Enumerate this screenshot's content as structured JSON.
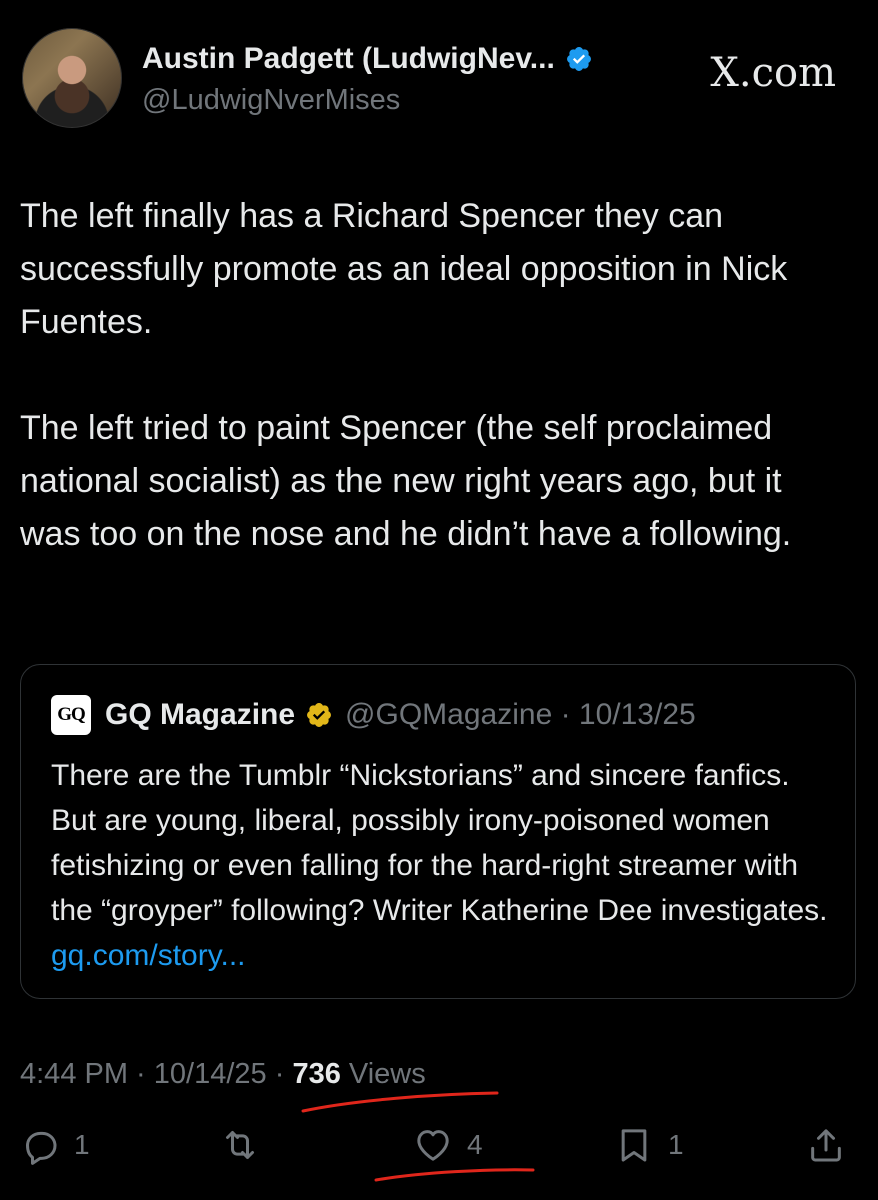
{
  "author": {
    "display_name": "Austin Padgett (LudwigNev...",
    "handle": "@LudwigNverMises",
    "verified_color": "#1d9bf0"
  },
  "site_logo": "X.com",
  "tweet": {
    "text": "The left finally has a Richard Spencer they can successfully promote as an ideal opposition in Nick Fuentes.\n\nThe left tried to paint Spencer (the self proclaimed national socialist) as the new right years ago, but it was too on the nose and he didn’t have a following."
  },
  "quoted_tweet": {
    "logo_text": "GQ",
    "name": "GQ Magazine",
    "handle_date": "@GQMagazine · 10/13/25",
    "badge_color": "#e2b719",
    "text": "There are the Tumblr “Nickstorians” and sincere fanfics. But are young, liberal, possibly irony-poisoned women fetishizing or even falling for the hard-right streamer with the “groyper” following? Writer Katherine Dee investigates. ",
    "link": "gq.com/story..."
  },
  "meta": {
    "timestamp": "4:44 PM · 10/14/25 · ",
    "views_count": "736",
    "views_label": "Views"
  },
  "actions": {
    "replies": "1",
    "reposts": "",
    "likes": "4",
    "bookmarks": "1"
  },
  "annotation_color": "#e0261b"
}
